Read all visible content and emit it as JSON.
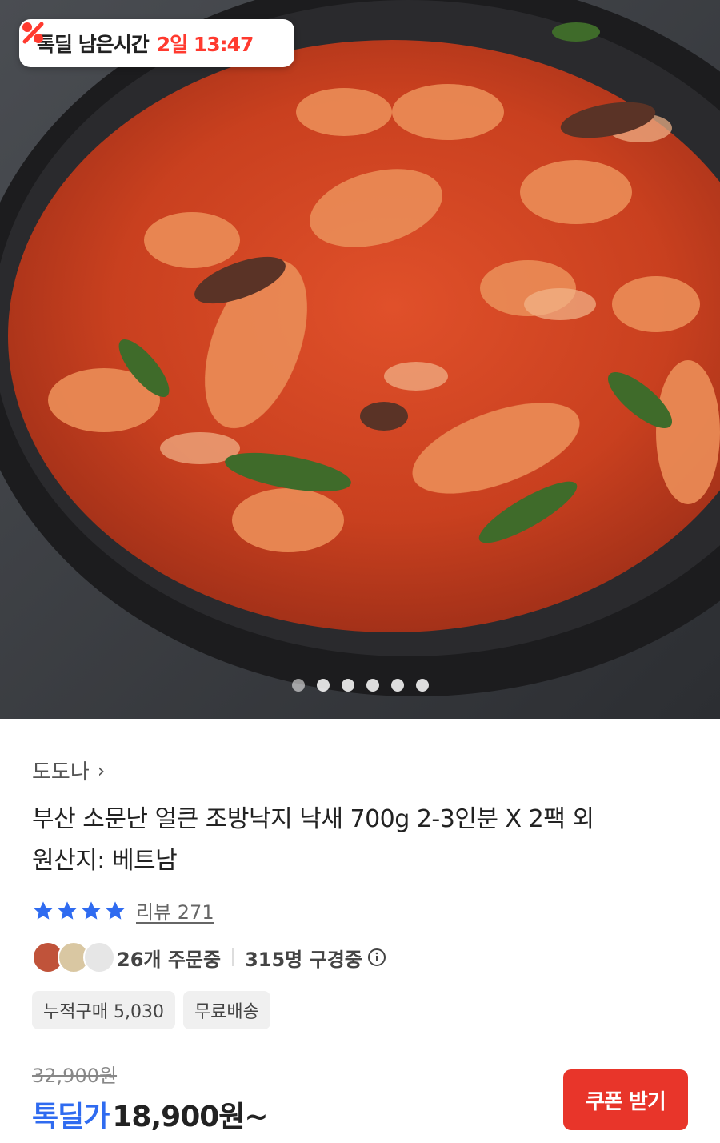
{
  "timer": {
    "icon": "discount-percent-icon",
    "label": "톡딜 남은시간",
    "value": "2일 13:47"
  },
  "carousel": {
    "total": 6,
    "active": 0
  },
  "product": {
    "seller": "도도나",
    "title_line1": "부산 소문난 얼큰 조방낙지 낙새 700g 2-3인분 X 2팩 외",
    "title_line2": "원산지: 베트남",
    "rating_stars": 4,
    "review_label": "리뷰 271",
    "orders": "26개 주문중",
    "watching": "315명 구경중",
    "badges": [
      "누적구매 5,030",
      "무료배송"
    ],
    "original_price": "32,900원",
    "deal_label": "톡딜가",
    "deal_price": "18,900원~",
    "coupon_button": "쿠폰 받기"
  },
  "colors": {
    "accent_red": "#e8352a",
    "timer_red": "#ff3a2f",
    "deal_blue": "#2f6bf0",
    "star_blue": "#2f6bf0"
  }
}
